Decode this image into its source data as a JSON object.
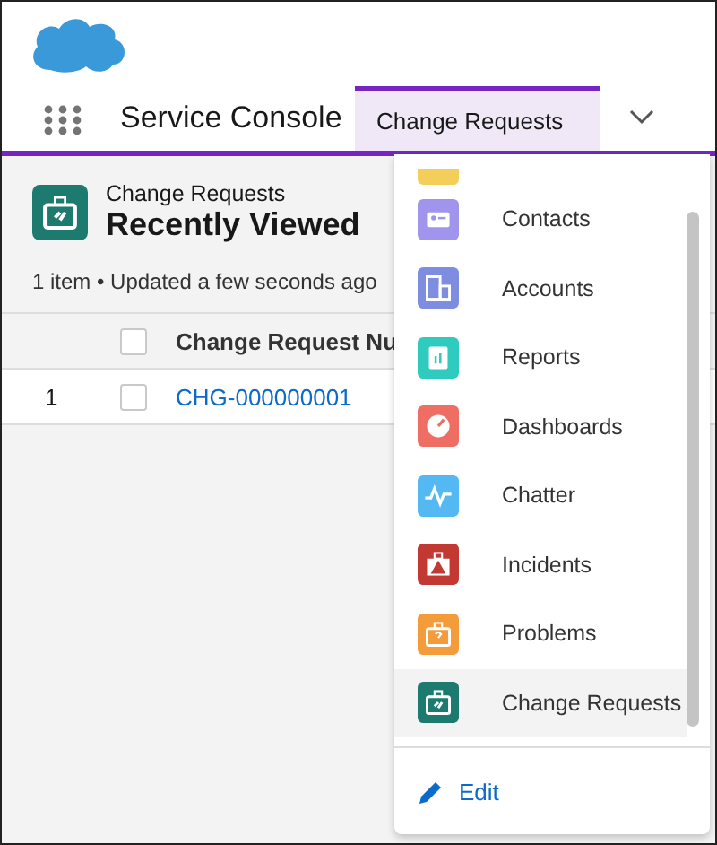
{
  "app": {
    "name": "Service Console"
  },
  "tabs": [
    {
      "label": "Change Requests",
      "selected": true
    }
  ],
  "list_view": {
    "object": "Change Requests",
    "title": "Recently Viewed",
    "status": "1 item • Updated a few seconds ago",
    "select_all": {
      "checked": false
    },
    "columns": [
      "Change Request Nu"
    ],
    "rows": [
      {
        "number": "1",
        "checked": false,
        "cells": [
          "CHG-000000001"
        ]
      }
    ]
  },
  "nav_menu": {
    "items": [
      {
        "kind": "cut",
        "color": "#f3cf5a",
        "selected": false
      },
      {
        "kind": "contacts",
        "label": "Contacts",
        "color": "#a094ed",
        "selected": false
      },
      {
        "kind": "accounts",
        "label": "Accounts",
        "color": "#7f8de1",
        "selected": false
      },
      {
        "kind": "reports",
        "label": "Reports",
        "color": "#2ecbbe",
        "selected": false
      },
      {
        "kind": "dashboards",
        "label": "Dashboards",
        "color": "#ef6e64",
        "selected": false
      },
      {
        "kind": "chatter",
        "label": "Chatter",
        "color": "#54b8f3",
        "selected": false
      },
      {
        "kind": "incidents",
        "label": "Incidents",
        "color": "#c23934",
        "selected": false
      },
      {
        "kind": "problems",
        "label": "Problems",
        "color": "#f49c3c",
        "selected": false
      },
      {
        "kind": "changes",
        "label": "Change Requests",
        "color": "#1d7a6e",
        "selected": true
      }
    ],
    "edit": "Edit"
  }
}
